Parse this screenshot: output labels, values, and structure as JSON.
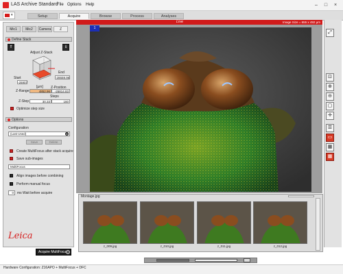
{
  "window": {
    "title": "LAS Archive Standard",
    "menu": [
      "File",
      "Options",
      "Help"
    ],
    "controls": [
      "–",
      "□",
      "×"
    ]
  },
  "tabs": [
    "Setup",
    "Acquire",
    "Browse",
    "Process",
    "Analyses"
  ],
  "active_tab": "Acquire",
  "left_panel": {
    "subtabs": [
      "Mic1",
      "Mic2",
      "Camera",
      "Z"
    ],
    "define_stack": {
      "header": "Define Stack",
      "adjust_label": "Adjust Z-Stack",
      "start_label": "Start",
      "start_value": "-26907",
      "end_label": "End",
      "end_value": "-28659.96",
      "unit": "[µm]",
      "zrange_label": "Z-Range",
      "zrange_value": "4852.96",
      "zposition_label": "Z-Position",
      "zposition_value": "-26814.83",
      "steps_label": "Steps",
      "steps_value": "160",
      "zstep_label": "Z-Step",
      "zstep_value": "30.33",
      "optimize_label": "Optimize step size"
    },
    "options": {
      "header": "Options",
      "configuration_label": "Configuration",
      "configuration_value": "(Last Used)",
      "save_label": "Save",
      "delete_label": "Delete",
      "checkboxes": [
        {
          "label": "Create MultiFocus after stack acquire",
          "checked": true
        },
        {
          "label": "Save sub-images",
          "checked": true
        },
        {
          "label": "Align images before combining",
          "checked": false
        },
        {
          "label": "Perform manual focus",
          "checked": false
        },
        {
          "label": "ms Wait before acquire",
          "checked": false
        }
      ],
      "name_value": "MultiFocus",
      "wait_value": "0"
    },
    "acquire_button": "Acquire MultiFocus",
    "logo_text": "Leica"
  },
  "main_view": {
    "live_label": "Live",
    "image_size": "Image Size = 655 x 492 µm",
    "badge": "1"
  },
  "montage": {
    "title": "Montage.jpg",
    "thumbnails": [
      "z_009.jpg",
      "z_010.jpg",
      "z_011.jpg",
      "z_012.jpg"
    ]
  },
  "status": {
    "text": "Hardware Configuration:  Z16APO + MultiFocus + DFC"
  },
  "colors": {
    "accent_red": "#d11b1b",
    "badge_blue": "#1c2fb5"
  },
  "icons": {
    "right_toolbar": [
      "expand-icon",
      "zoom-fit-icon",
      "zoom-in-icon",
      "zoom-out-icon",
      "zoom-actual-icon",
      "crosshair-icon",
      "list-icon",
      "overlay-icon",
      "grid-icon",
      "grid-red-icon"
    ]
  }
}
